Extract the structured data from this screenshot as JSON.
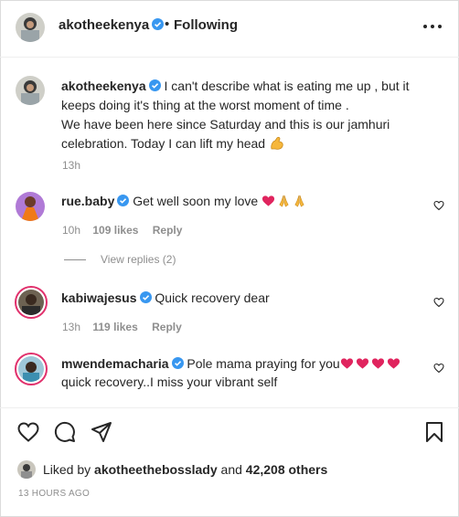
{
  "post": {
    "author": "akotheekenya",
    "separator": "•",
    "follow_status": "Following",
    "caption_line1": "I can't describe what is eating me up , but it keeps doing it's thing at the worst moment of time .",
    "caption_line2": "We have been here since Saturday and this is our jamhuri celebration. Today I can lift my head",
    "caption_time": "13h"
  },
  "comments": [
    {
      "user": "rue.baby",
      "text": "Get well soon my love",
      "time": "10h",
      "likes": "109 likes",
      "reply": "Reply",
      "view_replies": "View replies (2)"
    },
    {
      "user": "kabiwajesus",
      "text": "Quick recovery dear",
      "time": "13h",
      "likes": "119 likes",
      "reply": "Reply"
    },
    {
      "user": "mwendemacharia",
      "text": "Pole mama praying for you",
      "text2": "quick recovery..I miss your vibrant self"
    }
  ],
  "footer": {
    "liked_prefix": "Liked by",
    "liked_user": "akotheethebosslady",
    "liked_and": "and",
    "liked_others": "42,208 others",
    "time_ago": "13 HOURS AGO"
  },
  "colors": {
    "verified": "#3897f0",
    "heart_emoji": "#e0245e",
    "muted": "#8e8e8e",
    "text": "#262626"
  },
  "icons": {
    "more": "more-options-icon",
    "like": "heart-outline-icon",
    "comment": "comment-icon",
    "share": "share-icon",
    "save": "bookmark-icon"
  }
}
